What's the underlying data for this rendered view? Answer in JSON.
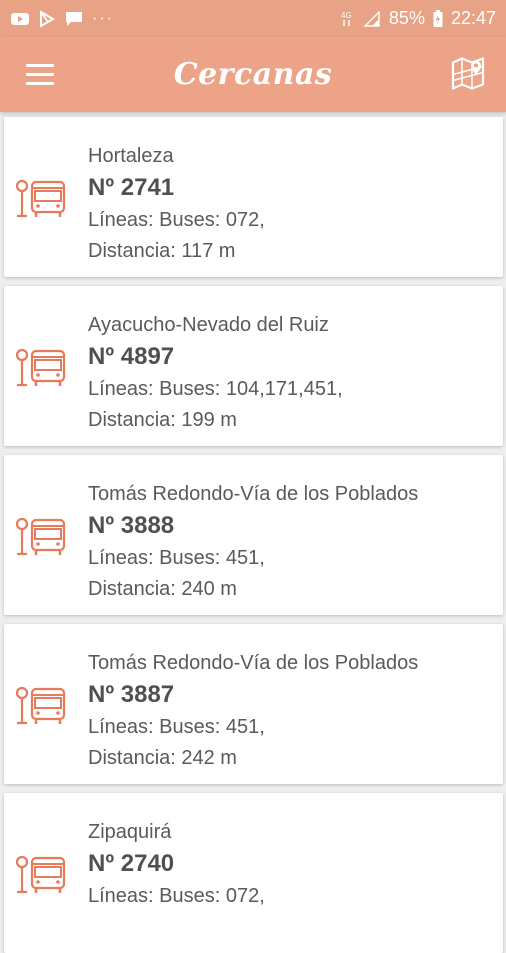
{
  "status_bar": {
    "left_icons": [
      "youtube-icon",
      "play-store-icon",
      "message-icon"
    ],
    "dots": "···",
    "network": "4G",
    "battery": "85%",
    "time": "22:47"
  },
  "app_bar": {
    "title": "Cercanas",
    "menu_icon": "hamburger-menu-icon",
    "map_icon": "map-icon"
  },
  "colors": {
    "primary": "#eda387",
    "status": "#e8a285",
    "accent_icon": "#e8795a",
    "background": "#eeeeee"
  },
  "stops": [
    {
      "name": "Hortaleza",
      "number": "Nº 2741",
      "lines": "Líneas: Buses: 072,",
      "distance": "Distancia: 117 m"
    },
    {
      "name": "Ayacucho-Nevado del Ruiz",
      "number": "Nº 4897",
      "lines": "Líneas: Buses: 104,171,451,",
      "distance": "Distancia: 199 m"
    },
    {
      "name": "Tomás Redondo-Vía de los Poblados",
      "number": "Nº 3888",
      "lines": "Líneas: Buses: 451,",
      "distance": "Distancia: 240 m"
    },
    {
      "name": "Tomás Redondo-Vía de los Poblados",
      "number": "Nº 3887",
      "lines": "Líneas: Buses: 451,",
      "distance": "Distancia: 242 m"
    },
    {
      "name": "Zipaquirá",
      "number": "Nº 2740",
      "lines": "Líneas: Buses: 072,",
      "distance": ""
    }
  ]
}
